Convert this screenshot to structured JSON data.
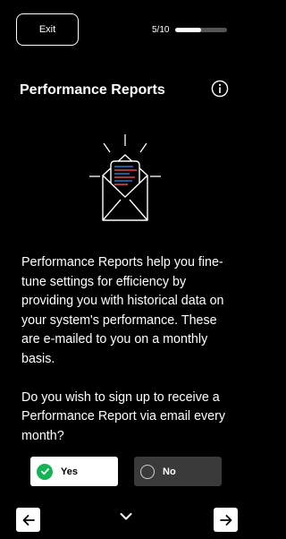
{
  "header": {
    "exit_label": "Exit",
    "progress_text": "5/10",
    "progress_fraction": 0.5
  },
  "page": {
    "title": "Performance Reports"
  },
  "icons": {
    "info": "info-icon",
    "illustration": "email-report-icon",
    "check": "check-icon",
    "back": "arrow-left-icon",
    "next": "arrow-right-icon",
    "expand": "chevron-down-icon"
  },
  "content": {
    "paragraph1": "Performance Reports help you fine-tune settings for efficiency by providing you with historical data on your system's performance. These are e-mailed to you on a monthly basis.",
    "paragraph2": "Do you wish to sign up to receive a Performance Report via email every month?"
  },
  "options": {
    "yes_label": "Yes",
    "no_label": "No",
    "selected": "Yes"
  },
  "colors": {
    "background": "#000000",
    "accent_green": "#15b356",
    "report_red": "#e8434f",
    "report_blue": "#3a6fd8"
  }
}
